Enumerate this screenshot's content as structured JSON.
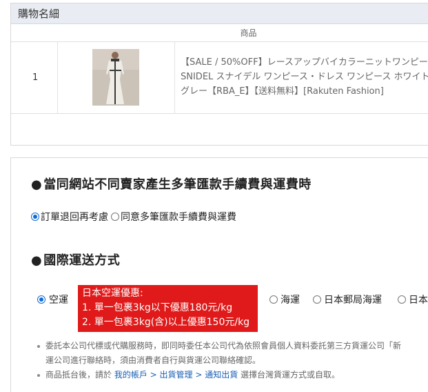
{
  "cart": {
    "header": "購物名細",
    "column_product": "商品",
    "items": [
      {
        "index": "1",
        "name": "【SALE / 50%OFF】レースアップバイカラーニットワンピース SNIDEL スナイデル ワンピース・ドレス ワンピース ホワイト グレー【RBA_E】【送料無料】[Rakuten Fashion]"
      }
    ]
  },
  "fee_section": {
    "title": "當同網站不同賣家產生多筆匯款手續費與運費時",
    "options": [
      {
        "label": "訂單退回再考慮",
        "checked": true
      },
      {
        "label": "同意多筆匯款手續費與運費",
        "checked": false
      }
    ]
  },
  "shipping_section": {
    "title": "國際運送方式",
    "options": [
      {
        "label": "空運",
        "checked": true
      },
      {
        "label": "海運",
        "checked": false
      },
      {
        "label": "日本郵局海運",
        "checked": false
      },
      {
        "label": "日本",
        "checked": false
      }
    ],
    "promo": {
      "title": "日本空運優惠:",
      "line1": "1. 單一包裹3kg以下優惠180元/kg",
      "line2": "2. 單一包裹3kg(含)以上優惠150元/kg"
    }
  },
  "notes": {
    "line1": "委託本公司代標或代購服務時，即同時委任本公司代為依照會員個人資料委託第三方貨運公司「新",
    "line2": "運公司進行聯絡時，須由消費者自行與貨運公司聯絡確認。",
    "line3_prefix": "商品抵台後，請於 ",
    "line3_link": "我的帳戶 > 出貨管理 > 通知出貨",
    "line3_suffix": " 選擇台灣貨運方式或自取。"
  },
  "colors": {
    "accent": "#0b6bd6",
    "promo_bg": "#e01a1a",
    "header_bg": "#e9edf3",
    "link": "#1a5fb4"
  }
}
